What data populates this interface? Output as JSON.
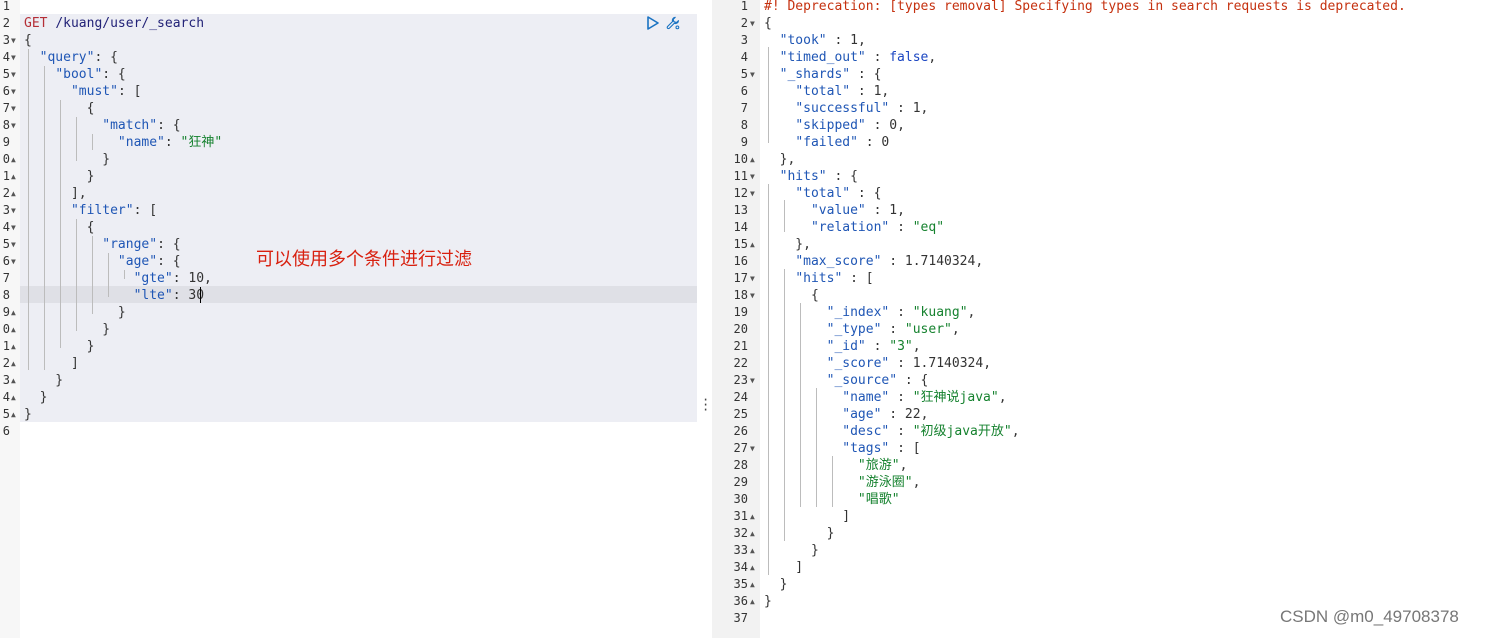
{
  "request": {
    "method": "GET",
    "path": "/kuang/user/_search",
    "annotation": "可以使用多个条件进行过滤",
    "lines": [
      {
        "n": "1",
        "fold": false,
        "t": []
      },
      {
        "n": "2",
        "fold": false,
        "t": [
          [
            "kw",
            "GET"
          ],
          [
            "p",
            " "
          ],
          [
            "pt",
            "/kuang/user/_search"
          ]
        ]
      },
      {
        "n": "3",
        "fold": true,
        "t": [
          [
            "p",
            "{"
          ]
        ]
      },
      {
        "n": "4",
        "fold": true,
        "t": [
          [
            "p",
            "  "
          ],
          [
            "k",
            "\"query\""
          ],
          [
            "p",
            ": {"
          ]
        ]
      },
      {
        "n": "5",
        "fold": true,
        "t": [
          [
            "p",
            "    "
          ],
          [
            "k",
            "\"bool\""
          ],
          [
            "p",
            ": {"
          ]
        ]
      },
      {
        "n": "6",
        "fold": true,
        "t": [
          [
            "p",
            "      "
          ],
          [
            "k",
            "\"must\""
          ],
          [
            "p",
            ": ["
          ]
        ]
      },
      {
        "n": "7",
        "fold": true,
        "t": [
          [
            "p",
            "        {"
          ]
        ]
      },
      {
        "n": "8",
        "fold": true,
        "t": [
          [
            "p",
            "          "
          ],
          [
            "k",
            "\"match\""
          ],
          [
            "p",
            ": {"
          ]
        ]
      },
      {
        "n": "9",
        "fold": false,
        "t": [
          [
            "p",
            "            "
          ],
          [
            "k",
            "\"name\""
          ],
          [
            "p",
            ": "
          ],
          [
            "s",
            "\"狂神\""
          ]
        ]
      },
      {
        "n": "0",
        "fold": true,
        "t": [
          [
            "p",
            "          }"
          ]
        ]
      },
      {
        "n": "1",
        "fold": true,
        "t": [
          [
            "p",
            "        }"
          ]
        ]
      },
      {
        "n": "2",
        "fold": true,
        "t": [
          [
            "p",
            "      ],"
          ]
        ]
      },
      {
        "n": "3",
        "fold": true,
        "t": [
          [
            "p",
            "      "
          ],
          [
            "k",
            "\"filter\""
          ],
          [
            "p",
            ": ["
          ]
        ]
      },
      {
        "n": "4",
        "fold": true,
        "t": [
          [
            "p",
            "        {"
          ]
        ]
      },
      {
        "n": "5",
        "fold": true,
        "t": [
          [
            "p",
            "          "
          ],
          [
            "k",
            "\"range\""
          ],
          [
            "p",
            ": {"
          ]
        ]
      },
      {
        "n": "6",
        "fold": true,
        "t": [
          [
            "p",
            "            "
          ],
          [
            "k",
            "\"age\""
          ],
          [
            "p",
            ": {"
          ]
        ]
      },
      {
        "n": "7",
        "fold": false,
        "t": [
          [
            "p",
            "              "
          ],
          [
            "k",
            "\"gte\""
          ],
          [
            "p",
            ": "
          ],
          [
            "n",
            "10"
          ],
          [
            "p",
            ","
          ]
        ]
      },
      {
        "n": "8",
        "fold": false,
        "t": [
          [
            "p",
            "              "
          ],
          [
            "k",
            "\"lte\""
          ],
          [
            "p",
            ": "
          ],
          [
            "n",
            "30"
          ]
        ]
      },
      {
        "n": "9",
        "fold": true,
        "t": [
          [
            "p",
            "            }"
          ]
        ]
      },
      {
        "n": "0",
        "fold": true,
        "t": [
          [
            "p",
            "          }"
          ]
        ]
      },
      {
        "n": "1",
        "fold": true,
        "t": [
          [
            "p",
            "        }"
          ]
        ]
      },
      {
        "n": "2",
        "fold": true,
        "t": [
          [
            "p",
            "      ]"
          ]
        ]
      },
      {
        "n": "3",
        "fold": true,
        "t": [
          [
            "p",
            "    }"
          ]
        ]
      },
      {
        "n": "4",
        "fold": true,
        "t": [
          [
            "p",
            "  }"
          ]
        ]
      },
      {
        "n": "5",
        "fold": true,
        "t": [
          [
            "p",
            "}"
          ]
        ]
      },
      {
        "n": "6",
        "fold": false,
        "t": []
      }
    ]
  },
  "response": {
    "lines": [
      {
        "n": "1",
        "fold": false,
        "t": [
          [
            "c",
            "#! Deprecation: [types removal] Specifying types in search requests is deprecated."
          ]
        ]
      },
      {
        "n": "2",
        "fold": true,
        "t": [
          [
            "p",
            "{"
          ]
        ]
      },
      {
        "n": "3",
        "fold": false,
        "t": [
          [
            "p",
            "  "
          ],
          [
            "k",
            "\"took\""
          ],
          [
            "p",
            " : "
          ],
          [
            "n",
            "1"
          ],
          [
            "p",
            ","
          ]
        ]
      },
      {
        "n": "4",
        "fold": false,
        "t": [
          [
            "p",
            "  "
          ],
          [
            "k",
            "\"timed_out\""
          ],
          [
            "p",
            " : "
          ],
          [
            "b",
            "false"
          ],
          [
            "p",
            ","
          ]
        ]
      },
      {
        "n": "5",
        "fold": true,
        "t": [
          [
            "p",
            "  "
          ],
          [
            "k",
            "\"_shards\""
          ],
          [
            "p",
            " : {"
          ]
        ]
      },
      {
        "n": "6",
        "fold": false,
        "t": [
          [
            "p",
            "    "
          ],
          [
            "k",
            "\"total\""
          ],
          [
            "p",
            " : "
          ],
          [
            "n",
            "1"
          ],
          [
            "p",
            ","
          ]
        ]
      },
      {
        "n": "7",
        "fold": false,
        "t": [
          [
            "p",
            "    "
          ],
          [
            "k",
            "\"successful\""
          ],
          [
            "p",
            " : "
          ],
          [
            "n",
            "1"
          ],
          [
            "p",
            ","
          ]
        ]
      },
      {
        "n": "8",
        "fold": false,
        "t": [
          [
            "p",
            "    "
          ],
          [
            "k",
            "\"skipped\""
          ],
          [
            "p",
            " : "
          ],
          [
            "n",
            "0"
          ],
          [
            "p",
            ","
          ]
        ]
      },
      {
        "n": "9",
        "fold": false,
        "t": [
          [
            "p",
            "    "
          ],
          [
            "k",
            "\"failed\""
          ],
          [
            "p",
            " : "
          ],
          [
            "n",
            "0"
          ]
        ]
      },
      {
        "n": "10",
        "fold": true,
        "t": [
          [
            "p",
            "  },"
          ]
        ]
      },
      {
        "n": "11",
        "fold": true,
        "t": [
          [
            "p",
            "  "
          ],
          [
            "k",
            "\"hits\""
          ],
          [
            "p",
            " : {"
          ]
        ]
      },
      {
        "n": "12",
        "fold": true,
        "t": [
          [
            "p",
            "    "
          ],
          [
            "k",
            "\"total\""
          ],
          [
            "p",
            " : {"
          ]
        ]
      },
      {
        "n": "13",
        "fold": false,
        "t": [
          [
            "p",
            "      "
          ],
          [
            "k",
            "\"value\""
          ],
          [
            "p",
            " : "
          ],
          [
            "n",
            "1"
          ],
          [
            "p",
            ","
          ]
        ]
      },
      {
        "n": "14",
        "fold": false,
        "t": [
          [
            "p",
            "      "
          ],
          [
            "k",
            "\"relation\""
          ],
          [
            "p",
            " : "
          ],
          [
            "s",
            "\"eq\""
          ]
        ]
      },
      {
        "n": "15",
        "fold": true,
        "t": [
          [
            "p",
            "    },"
          ]
        ]
      },
      {
        "n": "16",
        "fold": false,
        "t": [
          [
            "p",
            "    "
          ],
          [
            "k",
            "\"max_score\""
          ],
          [
            "p",
            " : "
          ],
          [
            "n",
            "1.7140324"
          ],
          [
            "p",
            ","
          ]
        ]
      },
      {
        "n": "17",
        "fold": true,
        "t": [
          [
            "p",
            "    "
          ],
          [
            "k",
            "\"hits\""
          ],
          [
            "p",
            " : ["
          ]
        ]
      },
      {
        "n": "18",
        "fold": true,
        "t": [
          [
            "p",
            "      {"
          ]
        ]
      },
      {
        "n": "19",
        "fold": false,
        "t": [
          [
            "p",
            "        "
          ],
          [
            "k",
            "\"_index\""
          ],
          [
            "p",
            " : "
          ],
          [
            "s",
            "\"kuang\""
          ],
          [
            "p",
            ","
          ]
        ]
      },
      {
        "n": "20",
        "fold": false,
        "t": [
          [
            "p",
            "        "
          ],
          [
            "k",
            "\"_type\""
          ],
          [
            "p",
            " : "
          ],
          [
            "s",
            "\"user\""
          ],
          [
            "p",
            ","
          ]
        ]
      },
      {
        "n": "21",
        "fold": false,
        "t": [
          [
            "p",
            "        "
          ],
          [
            "k",
            "\"_id\""
          ],
          [
            "p",
            " : "
          ],
          [
            "s",
            "\"3\""
          ],
          [
            "p",
            ","
          ]
        ]
      },
      {
        "n": "22",
        "fold": false,
        "t": [
          [
            "p",
            "        "
          ],
          [
            "k",
            "\"_score\""
          ],
          [
            "p",
            " : "
          ],
          [
            "n",
            "1.7140324"
          ],
          [
            "p",
            ","
          ]
        ]
      },
      {
        "n": "23",
        "fold": true,
        "t": [
          [
            "p",
            "        "
          ],
          [
            "k",
            "\"_source\""
          ],
          [
            "p",
            " : {"
          ]
        ]
      },
      {
        "n": "24",
        "fold": false,
        "t": [
          [
            "p",
            "          "
          ],
          [
            "k",
            "\"name\""
          ],
          [
            "p",
            " : "
          ],
          [
            "s",
            "\"狂神说java\""
          ],
          [
            "p",
            ","
          ]
        ]
      },
      {
        "n": "25",
        "fold": false,
        "t": [
          [
            "p",
            "          "
          ],
          [
            "k",
            "\"age\""
          ],
          [
            "p",
            " : "
          ],
          [
            "n",
            "22"
          ],
          [
            "p",
            ","
          ]
        ]
      },
      {
        "n": "26",
        "fold": false,
        "t": [
          [
            "p",
            "          "
          ],
          [
            "k",
            "\"desc\""
          ],
          [
            "p",
            " : "
          ],
          [
            "s",
            "\"初级java开放\""
          ],
          [
            "p",
            ","
          ]
        ]
      },
      {
        "n": "27",
        "fold": true,
        "t": [
          [
            "p",
            "          "
          ],
          [
            "k",
            "\"tags\""
          ],
          [
            "p",
            " : ["
          ]
        ]
      },
      {
        "n": "28",
        "fold": false,
        "t": [
          [
            "p",
            "            "
          ],
          [
            "s",
            "\"旅游\""
          ],
          [
            "p",
            ","
          ]
        ]
      },
      {
        "n": "29",
        "fold": false,
        "t": [
          [
            "p",
            "            "
          ],
          [
            "s",
            "\"游泳圈\""
          ],
          [
            "p",
            ","
          ]
        ]
      },
      {
        "n": "30",
        "fold": false,
        "t": [
          [
            "p",
            "            "
          ],
          [
            "s",
            "\"唱歌\""
          ]
        ]
      },
      {
        "n": "31",
        "fold": true,
        "t": [
          [
            "p",
            "          ]"
          ]
        ]
      },
      {
        "n": "32",
        "fold": true,
        "t": [
          [
            "p",
            "        }"
          ]
        ]
      },
      {
        "n": "33",
        "fold": true,
        "t": [
          [
            "p",
            "      }"
          ]
        ]
      },
      {
        "n": "34",
        "fold": true,
        "t": [
          [
            "p",
            "    ]"
          ]
        ]
      },
      {
        "n": "35",
        "fold": true,
        "t": [
          [
            "p",
            "  }"
          ]
        ]
      },
      {
        "n": "36",
        "fold": true,
        "t": [
          [
            "p",
            "}"
          ]
        ]
      },
      {
        "n": "37",
        "fold": false,
        "t": []
      }
    ]
  },
  "toolbar": {
    "run_icon": "play-icon",
    "settings_icon": "wrench-icon"
  },
  "watermark": "CSDN @m0_49708378",
  "colors": {
    "key": "#1f56b5",
    "string": "#16822f",
    "method": "#b42e36",
    "annotation": "#d8200f",
    "comment": "#c5310f"
  }
}
